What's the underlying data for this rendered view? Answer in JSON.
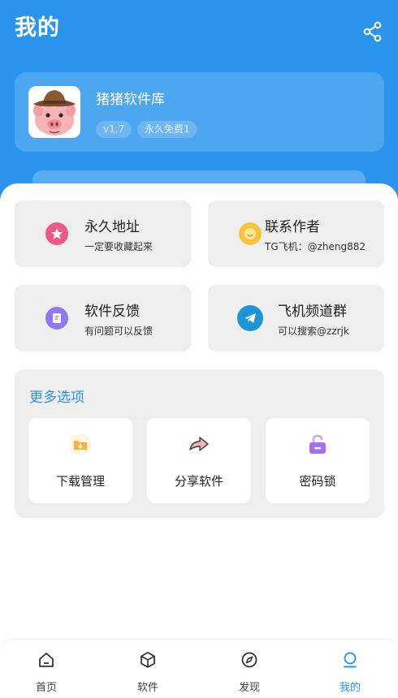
{
  "header": {
    "title": "我的",
    "share_icon": "share-icon"
  },
  "app": {
    "name": "猪猪软件库",
    "version": "v1.7",
    "free_badge": "永久免费1",
    "avatar_icon": "pig-cowboy-avatar"
  },
  "tiles": [
    {
      "title": "永久地址",
      "subtitle": "一定要收藏起来",
      "icon": "star-badge-icon",
      "color": "#f0588a"
    },
    {
      "title": "联系作者",
      "subtitle": "TG飞机：@zheng882",
      "icon": "smile-icon",
      "color": "#f6c43d"
    },
    {
      "title": "软件反馈",
      "subtitle": "有问题可以反馈",
      "icon": "feedback-icon",
      "color": "#8f78f0"
    },
    {
      "title": "飞机频道群",
      "subtitle": "可以搜索@zzrjk",
      "icon": "telegram-icon",
      "color": "#1e94d8"
    }
  ],
  "more": {
    "title": "更多选项",
    "options": [
      {
        "label": "下载管理",
        "icon": "download-folder-icon",
        "color": "#f6b23c"
      },
      {
        "label": "分享软件",
        "icon": "share-arrow-icon",
        "color": "#f3b6ad"
      },
      {
        "label": "密码锁",
        "icon": "unlock-icon",
        "color": "#a270f0"
      }
    ]
  },
  "nav": {
    "items": [
      {
        "label": "首页",
        "icon": "home-icon"
      },
      {
        "label": "软件",
        "icon": "cube-icon"
      },
      {
        "label": "发现",
        "icon": "compass-icon"
      },
      {
        "label": "我的",
        "icon": "profile-icon",
        "active": true
      }
    ],
    "active_color": "#2b95ee"
  },
  "colors": {
    "primary": "#2b95ee",
    "tile_bg": "#eeeeee"
  }
}
